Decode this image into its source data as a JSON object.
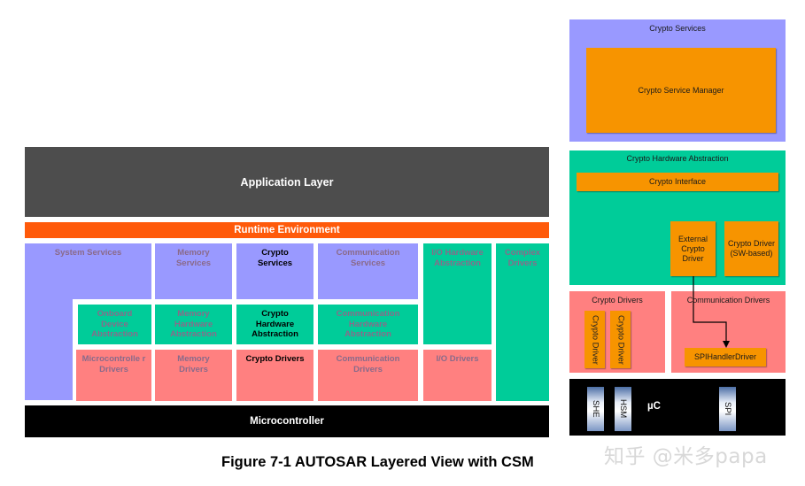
{
  "diagram": {
    "left_stack": {
      "application_layer": "Application Layer",
      "runtime_environment": "Runtime Environment",
      "microcontroller": "Microcontroller",
      "modules": {
        "system_services": "System Services",
        "memory_services": "Memory Services",
        "crypto_services": "Crypto Services",
        "communication_services": "Communication Services",
        "io_hardware_abstraction": "I/O Hardware Abstraction",
        "complex_drivers": "Complex Drivers",
        "onboard_device_abstraction": "Onboard Device Abstraction",
        "memory_hardware_abstraction": "Memory Hardware Abstraction",
        "crypto_hardware_abstraction": "Crypto Hardware Abstraction",
        "communication_hardware_abstraction": "Communication Hardware Abstraction",
        "microcontroller_drivers": "Microcontrolle r Drivers",
        "memory_drivers": "Memory Drivers",
        "crypto_drivers": "Crypto Drivers",
        "communication_drivers": "Communication Drivers",
        "io_drivers": "I/O Drivers"
      }
    },
    "right_stack": {
      "crypto_services": {
        "title": "Crypto Services",
        "csm": "Crypto Service Manager"
      },
      "crypto_hw_abstraction": {
        "title": "Crypto Hardware Abstraction",
        "crypto_interface": "Crypto Interface",
        "external_crypto_driver": "External Crypto Driver",
        "sw_crypto_driver": "Crypto Driver (SW-based)"
      },
      "crypto_drivers": {
        "title": "Crypto Drivers",
        "drivers": [
          "Crypto Driver",
          "Crypto Driver"
        ]
      },
      "communication_drivers": {
        "title": "Communication Drivers",
        "spi_handler": "SPIHandlerDriver"
      },
      "microcontroller": {
        "label": "µC",
        "chips": [
          "SHE",
          "HSM",
          "SPI"
        ]
      }
    },
    "caption": "Figure 7-1 AUTOSAR Layered View with CSM",
    "watermark": "知乎 @米多papa",
    "colors": {
      "application": "#4d4d4d",
      "rte": "#ff5a0a",
      "services": "#9999ff",
      "hw_abstraction": "#00cc99",
      "drivers": "#ff8080",
      "orange_module": "#f79400",
      "microcontroller": "#000000"
    }
  }
}
